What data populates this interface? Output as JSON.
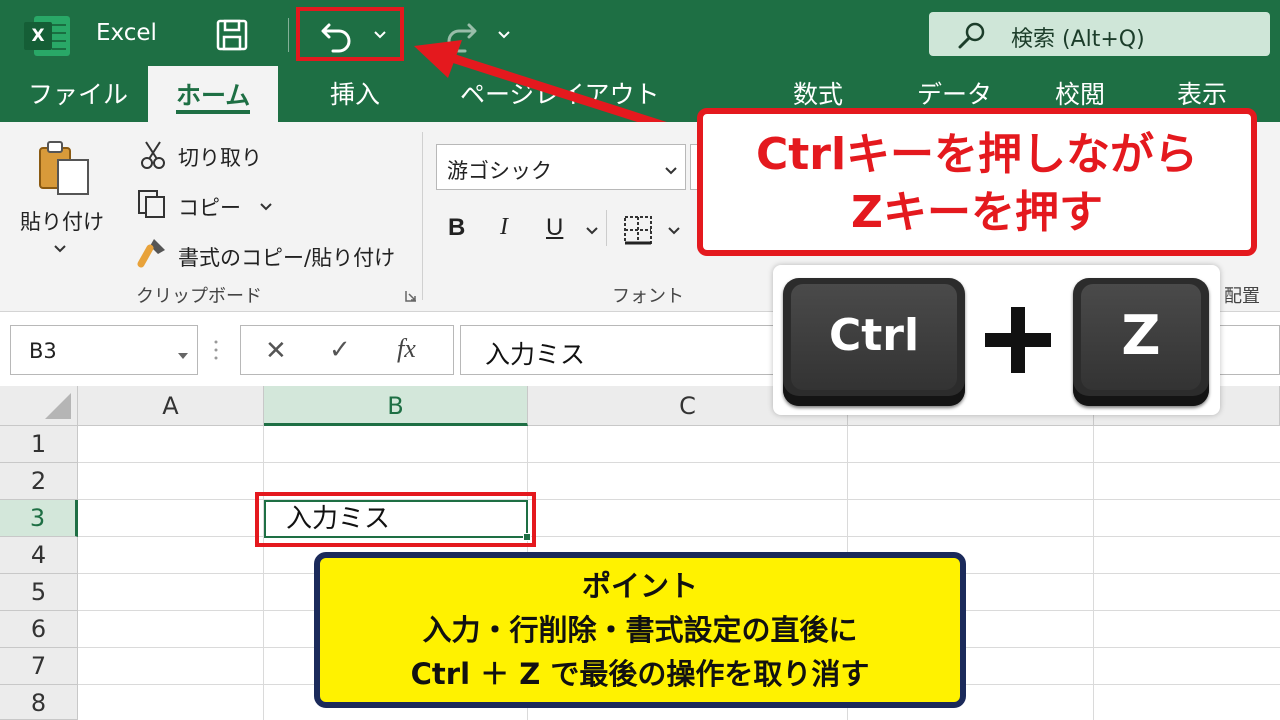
{
  "titlebar": {
    "app_name": "Excel",
    "logo_letter": "X",
    "search_text": "検索 (Alt+Q)",
    "accent_color": "#1e6f44",
    "highlight_color": "#e4191e",
    "icons": [
      "save-icon",
      "undo-icon",
      "redo-icon",
      "chevron-down-icon",
      "search-icon"
    ]
  },
  "tabs": {
    "file": "ファイル",
    "home": "ホーム",
    "insert": "挿入",
    "page_layout": "ページレイアウト",
    "formulas": "数式",
    "data": "データ",
    "review": "校閲",
    "view": "表示"
  },
  "ribbon": {
    "clipboard": {
      "paste": "貼り付け",
      "cut": "切り取り",
      "copy": "コピー",
      "format_painter": "書式のコピー/貼り付け",
      "group_label": "クリップボード"
    },
    "font": {
      "font_name": "游ゴシック",
      "bold": "B",
      "italic": "I",
      "underline": "U",
      "group_label": "フォント"
    },
    "alignment": {
      "group_label": "配置"
    }
  },
  "formula_bar": {
    "name_box": "B3",
    "cancel": "✕",
    "enter": "✓",
    "fx": "fx",
    "content": "入力ミス"
  },
  "sheet": {
    "columns": [
      "A",
      "B",
      "C"
    ],
    "rows": [
      "1",
      "2",
      "3",
      "4",
      "5",
      "6",
      "7",
      "8"
    ],
    "selected_cell": "B3",
    "b3_value": "入力ミス"
  },
  "callout": {
    "line1": "Ctrlキーを押しながら",
    "line2": "Zキーを押す"
  },
  "keys": {
    "key1": "Ctrl",
    "key2": "Z"
  },
  "point": {
    "heading": "ポイント",
    "line1": "入力・行削除・書式設定の直後に",
    "line2": "Ctrl ＋ Z で最後の操作を取り消す"
  }
}
